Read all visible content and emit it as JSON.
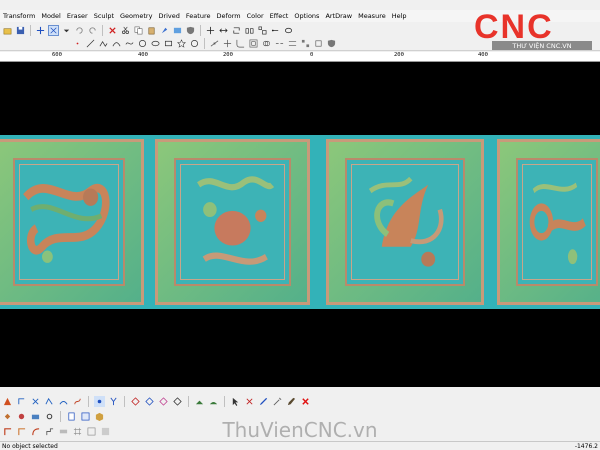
{
  "menu": [
    "Transform",
    "Model",
    "Eraser",
    "Sculpt",
    "Geometry",
    "Drived",
    "Feature",
    "Deform",
    "Color",
    "Effect",
    "Options",
    "ArtDraw",
    "Measure",
    "Help"
  ],
  "ruler": {
    "labels": [
      "600",
      "400",
      "200",
      "0",
      "200",
      "400"
    ]
  },
  "logo": {
    "brand": "CNC",
    "subtitle": "THƯ VIỆN CNC.VN",
    "colors": {
      "red": "#e8332a",
      "gray": "#8a8a8a"
    }
  },
  "watermark": "ThuVienCNC.vn",
  "status": {
    "message": "No object selected",
    "coords": "-1476.2"
  },
  "toolbar_icons": [
    "open-icon",
    "save-icon",
    "plus-icon",
    "select-icon",
    "dropdown-icon",
    "undo-icon",
    "redo-icon",
    "delete-icon",
    "cut-icon",
    "copy-icon",
    "paste-icon",
    "paint-icon",
    "view-icon",
    "shield-icon",
    "move-icon",
    "scale-icon",
    "rotate-icon",
    "mirror-icon",
    "align-icon",
    "group-icon",
    "cloud-icon"
  ],
  "colors": {
    "viewport_bg": "#000000",
    "relief_teal": "#3db3b6",
    "relief_green": "#7cc27a",
    "relief_copper": "#c89a7a"
  }
}
